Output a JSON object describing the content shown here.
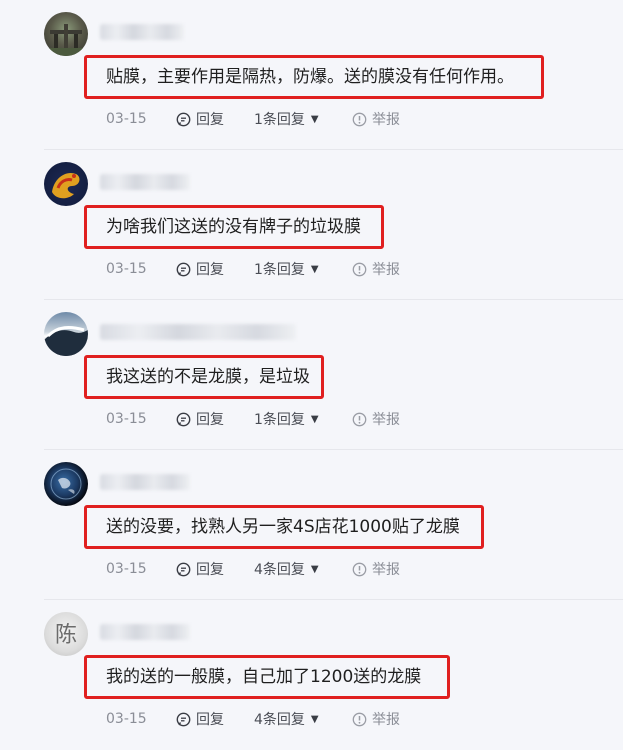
{
  "comments": [
    {
      "content": "贴膜，主要作用是隔热，防爆。送的膜没有任何作用。",
      "date": "03-15",
      "reply_label": "回复",
      "replies_label": "1条回复",
      "report_label": "举报"
    },
    {
      "content": "为啥我们这送的没有牌子的垃圾膜",
      "date": "03-15",
      "reply_label": "回复",
      "replies_label": "1条回复",
      "report_label": "举报"
    },
    {
      "content": "我这送的不是龙膜，是垃圾",
      "date": "03-15",
      "reply_label": "回复",
      "replies_label": "1条回复",
      "report_label": "举报"
    },
    {
      "content": "送的没要，找熟人另一家4S店花1000贴了龙膜",
      "date": "03-15",
      "reply_label": "回复",
      "replies_label": "4条回复",
      "report_label": "举报"
    },
    {
      "content": "我的送的一般膜，自己加了1200送的龙膜",
      "date": "03-15",
      "reply_label": "回复",
      "replies_label": "4条回复",
      "report_label": "举报"
    }
  ],
  "avatar_glyph_5": "陈",
  "colors": {
    "highlight_border": "#e01f1f",
    "page_background": "#f5f6fa",
    "meta_text": "#8a8d96"
  },
  "icons": {
    "reply": "chat-bubble-icon",
    "thread_toggle": "caret-down-icon",
    "report": "info-circle-icon"
  }
}
